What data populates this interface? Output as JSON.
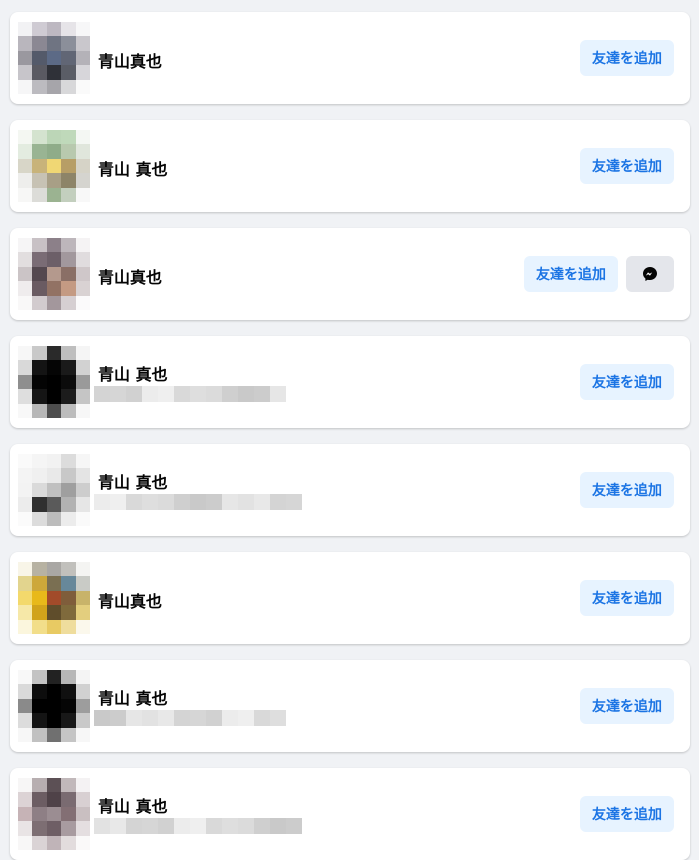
{
  "add_friend_label": "友達を追加",
  "people": [
    {
      "name": "青山真也",
      "subtext": null,
      "has_messenger": false,
      "avatar_pixels": [
        "#f2f2f4",
        "#cfcbd3",
        "#bdb8c1",
        "#e6e4e8",
        "#f7f7f8",
        "#b9b6bd",
        "#8b8893",
        "#6f7482",
        "#8b8f9a",
        "#c9c7cc",
        "#9a989f",
        "#545a6a",
        "#5c6a86",
        "#616675",
        "#b4b2b8",
        "#c7c5ca",
        "#5a5a62",
        "#2f3138",
        "#5a5d66",
        "#d7d6da",
        "#f6f6f7",
        "#bcbbc0",
        "#a6a5aa",
        "#d8d8da",
        "#fafafa"
      ]
    },
    {
      "name": "青山 真也",
      "subtext": null,
      "has_messenger": false,
      "avatar_pixels": [
        "#f4f7f2",
        "#d4e3cf",
        "#bcd6b7",
        "#bfd9ba",
        "#f4f7f3",
        "#e3ece0",
        "#99b493",
        "#8fac89",
        "#b8c9ae",
        "#e0e6dc",
        "#d8d6c8",
        "#c8b37a",
        "#f0d774",
        "#b79e66",
        "#d6d3c7",
        "#eeeeec",
        "#c7c2b4",
        "#a89f86",
        "#8d8468",
        "#d5d4cf",
        "#f7f7f6",
        "#dcdcd8",
        "#9bb391",
        "#c3cfbe",
        "#f8f8f8"
      ]
    },
    {
      "name": "青山真也",
      "subtext": null,
      "has_messenger": true,
      "avatar_pixels": [
        "#f6f5f6",
        "#c8c1c5",
        "#8c8089",
        "#bdb6bb",
        "#f5f3f4",
        "#e2dedf",
        "#7a6c75",
        "#6c5f68",
        "#a2989d",
        "#e0dcde",
        "#cbc4c6",
        "#54484f",
        "#b4998d",
        "#8a6f66",
        "#cfc7c9",
        "#efeced",
        "#6a5b62",
        "#927264",
        "#c49a83",
        "#d9d2d3",
        "#f9f8f8",
        "#d2cbce",
        "#a3979c",
        "#d6cfd2",
        "#fbfafb"
      ]
    },
    {
      "name": "青山 真也",
      "subtext": true,
      "has_messenger": false,
      "avatar_pixels": [
        "#f7f7f7",
        "#c9c9c9",
        "#2a2a2a",
        "#bebebe",
        "#f5f5f5",
        "#d9d9d9",
        "#141414",
        "#050505",
        "#1a1a1a",
        "#d2d2d2",
        "#8e8e8e",
        "#040404",
        "#000000",
        "#0b0b0b",
        "#9a9a9a",
        "#dedede",
        "#151515",
        "#000000",
        "#1c1c1c",
        "#c5c5c5",
        "#f8f8f8",
        "#b7b7b7",
        "#4d4d4d",
        "#bcbcbc",
        "#f7f7f7"
      ]
    },
    {
      "name": "青山 真也",
      "subtext": true,
      "has_messenger": false,
      "avatar_pixels": [
        "#fafafa",
        "#f5f5f5",
        "#f2f2f2",
        "#dcdcdc",
        "#f6f6f6",
        "#f4f4f4",
        "#f0f0f0",
        "#e9e9e9",
        "#c8c8c8",
        "#e4e4e4",
        "#f3f3f3",
        "#dadada",
        "#c0c0c0",
        "#9f9f9f",
        "#cdcdcd",
        "#ececec",
        "#303030",
        "#5a5a5a",
        "#b2b2b2",
        "#e6e6e6",
        "#fbfbfb",
        "#dcdcdc",
        "#bcbcbc",
        "#ececec",
        "#fafafa"
      ]
    },
    {
      "name": "青山真也",
      "subtext": null,
      "has_messenger": false,
      "avatar_pixels": [
        "#f8f5e8",
        "#b7b2a2",
        "#a9a7a4",
        "#c1c0bc",
        "#f4f4f2",
        "#e2d48e",
        "#cda83a",
        "#7a6f52",
        "#67889a",
        "#c9cbc6",
        "#f3d96c",
        "#e8b91a",
        "#a24b2a",
        "#7f5d3b",
        "#c8b36a",
        "#f6e8a8",
        "#d1a31b",
        "#5f4d2b",
        "#7f6a3c",
        "#e3ce7e",
        "#fbf6dd",
        "#f2de8a",
        "#e8ca63",
        "#efdd9d",
        "#fbf8ec"
      ]
    },
    {
      "name": "青山 真也",
      "subtext": true,
      "has_messenger": false,
      "avatar_pixels": [
        "#f8f8f8",
        "#c3c3c3",
        "#222222",
        "#b7b7b7",
        "#f4f4f4",
        "#dadada",
        "#0d0d0d",
        "#000000",
        "#101010",
        "#d1d1d1",
        "#8a8a8a",
        "#000000",
        "#000000",
        "#050505",
        "#9d9d9d",
        "#dcdcdc",
        "#141414",
        "#000000",
        "#181818",
        "#c9c9c9",
        "#f7f7f7",
        "#c1c1c1",
        "#707070",
        "#c5c5c5",
        "#f7f7f7"
      ]
    },
    {
      "name": "青山 真也",
      "subtext": true,
      "has_messenger": false,
      "avatar_pixels": [
        "#f7f6f6",
        "#b7aeb0",
        "#5c5055",
        "#c1b8ba",
        "#f4f2f3",
        "#dcd3d5",
        "#6c5d63",
        "#4f4248",
        "#7a6b71",
        "#d8d0d2",
        "#c6b3b6",
        "#8e7f85",
        "#9b8d92",
        "#836f74",
        "#c9bfc1",
        "#e9e4e5",
        "#7d6e73",
        "#6e5e65",
        "#a89ba0",
        "#e4dee0",
        "#f8f7f7",
        "#dad3d5",
        "#c0b4b8",
        "#e2dcdd",
        "#faf9f9"
      ]
    }
  ]
}
